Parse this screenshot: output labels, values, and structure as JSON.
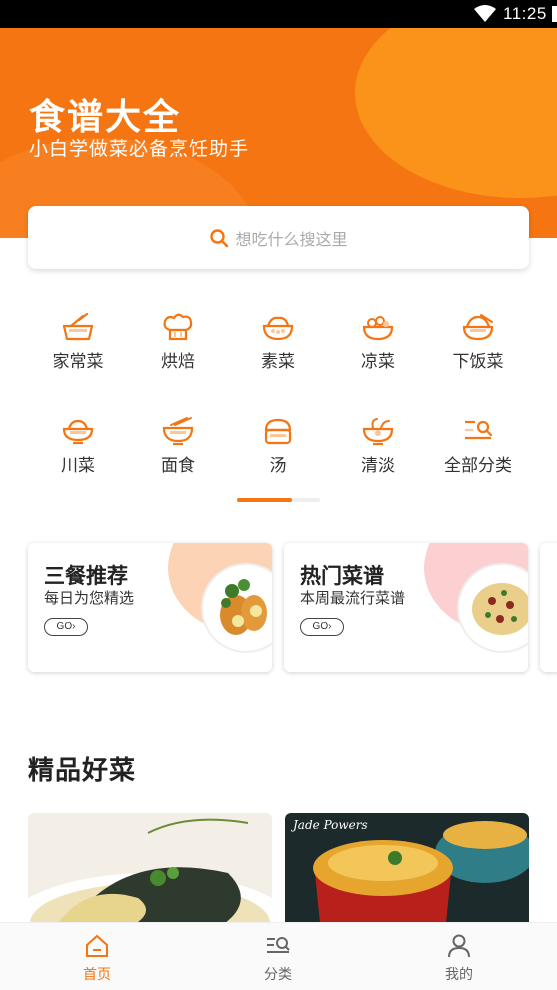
{
  "status_bar": {
    "time": "11:25"
  },
  "hero": {
    "title": "食谱大全",
    "subtitle": "小白学做菜必备烹饪助手"
  },
  "search": {
    "placeholder": "想吃什么搜这里"
  },
  "categories": [
    {
      "label": "家常菜",
      "icon": "home-cooking-icon"
    },
    {
      "label": "烘焙",
      "icon": "baking-chef-hat-icon"
    },
    {
      "label": "素菜",
      "icon": "vegetable-dish-icon"
    },
    {
      "label": "凉菜",
      "icon": "cold-dish-icon"
    },
    {
      "label": "下饭菜",
      "icon": "rice-dish-icon"
    },
    {
      "label": "川菜",
      "icon": "sichuan-bowl-icon"
    },
    {
      "label": "面食",
      "icon": "noodle-bowl-icon"
    },
    {
      "label": "汤",
      "icon": "soup-pot-icon"
    },
    {
      "label": "清淡",
      "icon": "light-salad-icon"
    },
    {
      "label": "全部分类",
      "icon": "all-categories-icon"
    }
  ],
  "feature_cards": [
    {
      "title": "三餐推荐",
      "subtitle": "每日为您精选",
      "go": "GO",
      "blob_color": "#fdd3b5"
    },
    {
      "title": "热门菜谱",
      "subtitle": "本周最流行菜谱",
      "go": "GO",
      "blob_color": "#fcd0d0"
    }
  ],
  "section": {
    "title": "精品好菜"
  },
  "tabs": [
    {
      "label": "首页",
      "icon": "home-icon",
      "active": true
    },
    {
      "label": "分类",
      "icon": "category-list-icon",
      "active": false
    },
    {
      "label": "我的",
      "icon": "user-icon",
      "active": false
    }
  ],
  "colors": {
    "accent": "#f47511",
    "accent_light": "#fb921a"
  }
}
